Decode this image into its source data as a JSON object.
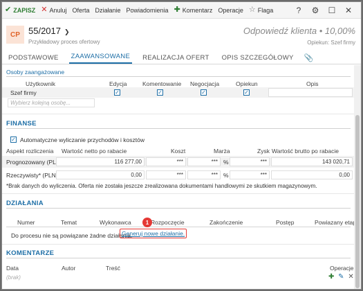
{
  "toolbar": {
    "save": "ZAPISZ",
    "cancel": "Anuluj",
    "offer": "Oferta",
    "action": "Działanie",
    "notifications": "Powiadomienia",
    "comment": "Komentarz",
    "operations": "Operacje",
    "flag": "Flaga"
  },
  "header": {
    "avatar": "CP",
    "number": "55/2017",
    "subtitle": "Przykładowy proces ofertowy",
    "status": "Odpowiedź klienta • 10,00%",
    "owner": "Opiekun: Szef firmy"
  },
  "tabs": [
    "PODSTAWOWE",
    "ZAAWANSOWANE",
    "REALIZACJA OFERT",
    "OPIS SZCZEGÓŁOWY"
  ],
  "involved": {
    "title": "Osoby zaangażowane",
    "columns": [
      "Użytkownik",
      "Edycja",
      "Komentowanie",
      "Negocjacja",
      "Opiekun",
      "Opis"
    ],
    "user": "Szef firmy",
    "placeholder": "Wybierz kolejną osobę..."
  },
  "finance": {
    "title": "FINANSE",
    "auto_label": "Automatyczne wyliczanie przychodów i kosztów",
    "columns": [
      "Aspekt rozliczenia",
      "Wartość netto po rabacie",
      "Koszt",
      "Marża",
      "Zysk",
      "Wartość brutto po rabacie"
    ],
    "rows": [
      {
        "label": "Prognozowany (PLN)",
        "net": "116 277,00",
        "cost": "***",
        "margin": "***",
        "pct": "%",
        "profit": "***",
        "gross": "143 020,71"
      },
      {
        "label": "Rzeczywisty* (PLN)",
        "net": "0,00",
        "cost": "***",
        "margin": "***",
        "pct": "%",
        "profit": "***",
        "gross": "0,00"
      }
    ],
    "note": "*Brak danych do wyliczenia. Oferta nie została jeszcze zrealizowana dokumentami handlowymi ze skutkiem magazynowym."
  },
  "actions": {
    "title": "DZIAŁANIA",
    "columns": [
      "Numer",
      "Temat",
      "Wykonawca",
      "Rozpoczęcie",
      "Zakończenie",
      "Postęp",
      "Powiazany etap"
    ],
    "empty_text": "Do procesu nie są powiązane żadne działania.",
    "generate_link": "Generuj nowe działanie.",
    "badge": "1"
  },
  "comments": {
    "title": "KOMENTARZE",
    "columns": [
      "Data",
      "Autor",
      "Treść",
      "Operacje"
    ],
    "empty": "(brak)"
  },
  "colors": {
    "accent": "#1d6ea6",
    "save_green": "#2e7d32",
    "cancel_red": "#d32f2f",
    "highlight": "#e53935"
  }
}
